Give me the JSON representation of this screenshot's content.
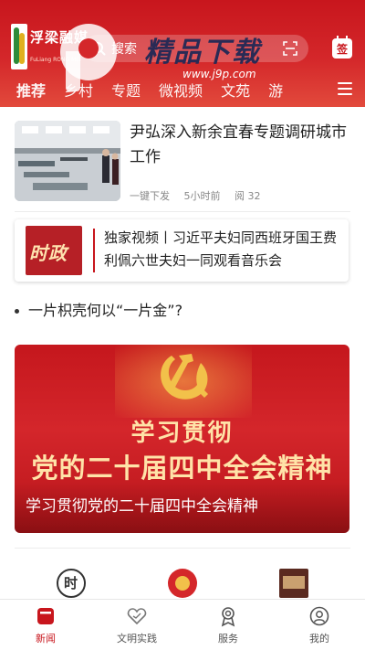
{
  "header": {
    "logo_name": "浮梁融媒",
    "logo_sub": "FuLiang RONG MEI",
    "search_label": "搜索",
    "sign_label": "签",
    "watermark_text": "精品下载",
    "watermark_url": "www.j9p.com"
  },
  "nav": {
    "tabs": [
      "推荐",
      "乡村",
      "专题",
      "微视频",
      "文苑",
      "游"
    ]
  },
  "news": {
    "title": "尹弘深入新余宜春专题调研城市工作",
    "source": "一键下发",
    "time": "5小时前",
    "reads": "阅 32"
  },
  "featured": {
    "thumb_label": "时政",
    "title": "独家视频丨习近平夫妇同西班牙国王费利佩六世夫妇一同观看音乐会"
  },
  "bullet": {
    "text": "一片枳壳何以“一片金”?"
  },
  "banner": {
    "line1": "学习贯彻",
    "line2": "党的二十届四中全会精神",
    "caption": "学习贯彻党的二十届四中全会精神"
  },
  "bottom_nav": {
    "items": [
      {
        "label": "新闻",
        "icon": "news-icon",
        "active": true
      },
      {
        "label": "文明实践",
        "icon": "heart-icon",
        "active": false
      },
      {
        "label": "服务",
        "icon": "service-icon",
        "active": false
      },
      {
        "label": "我的",
        "icon": "profile-icon",
        "active": false
      }
    ]
  },
  "colors": {
    "brand_red": "#c8161d",
    "banner_gold": "#ffe3a8"
  }
}
